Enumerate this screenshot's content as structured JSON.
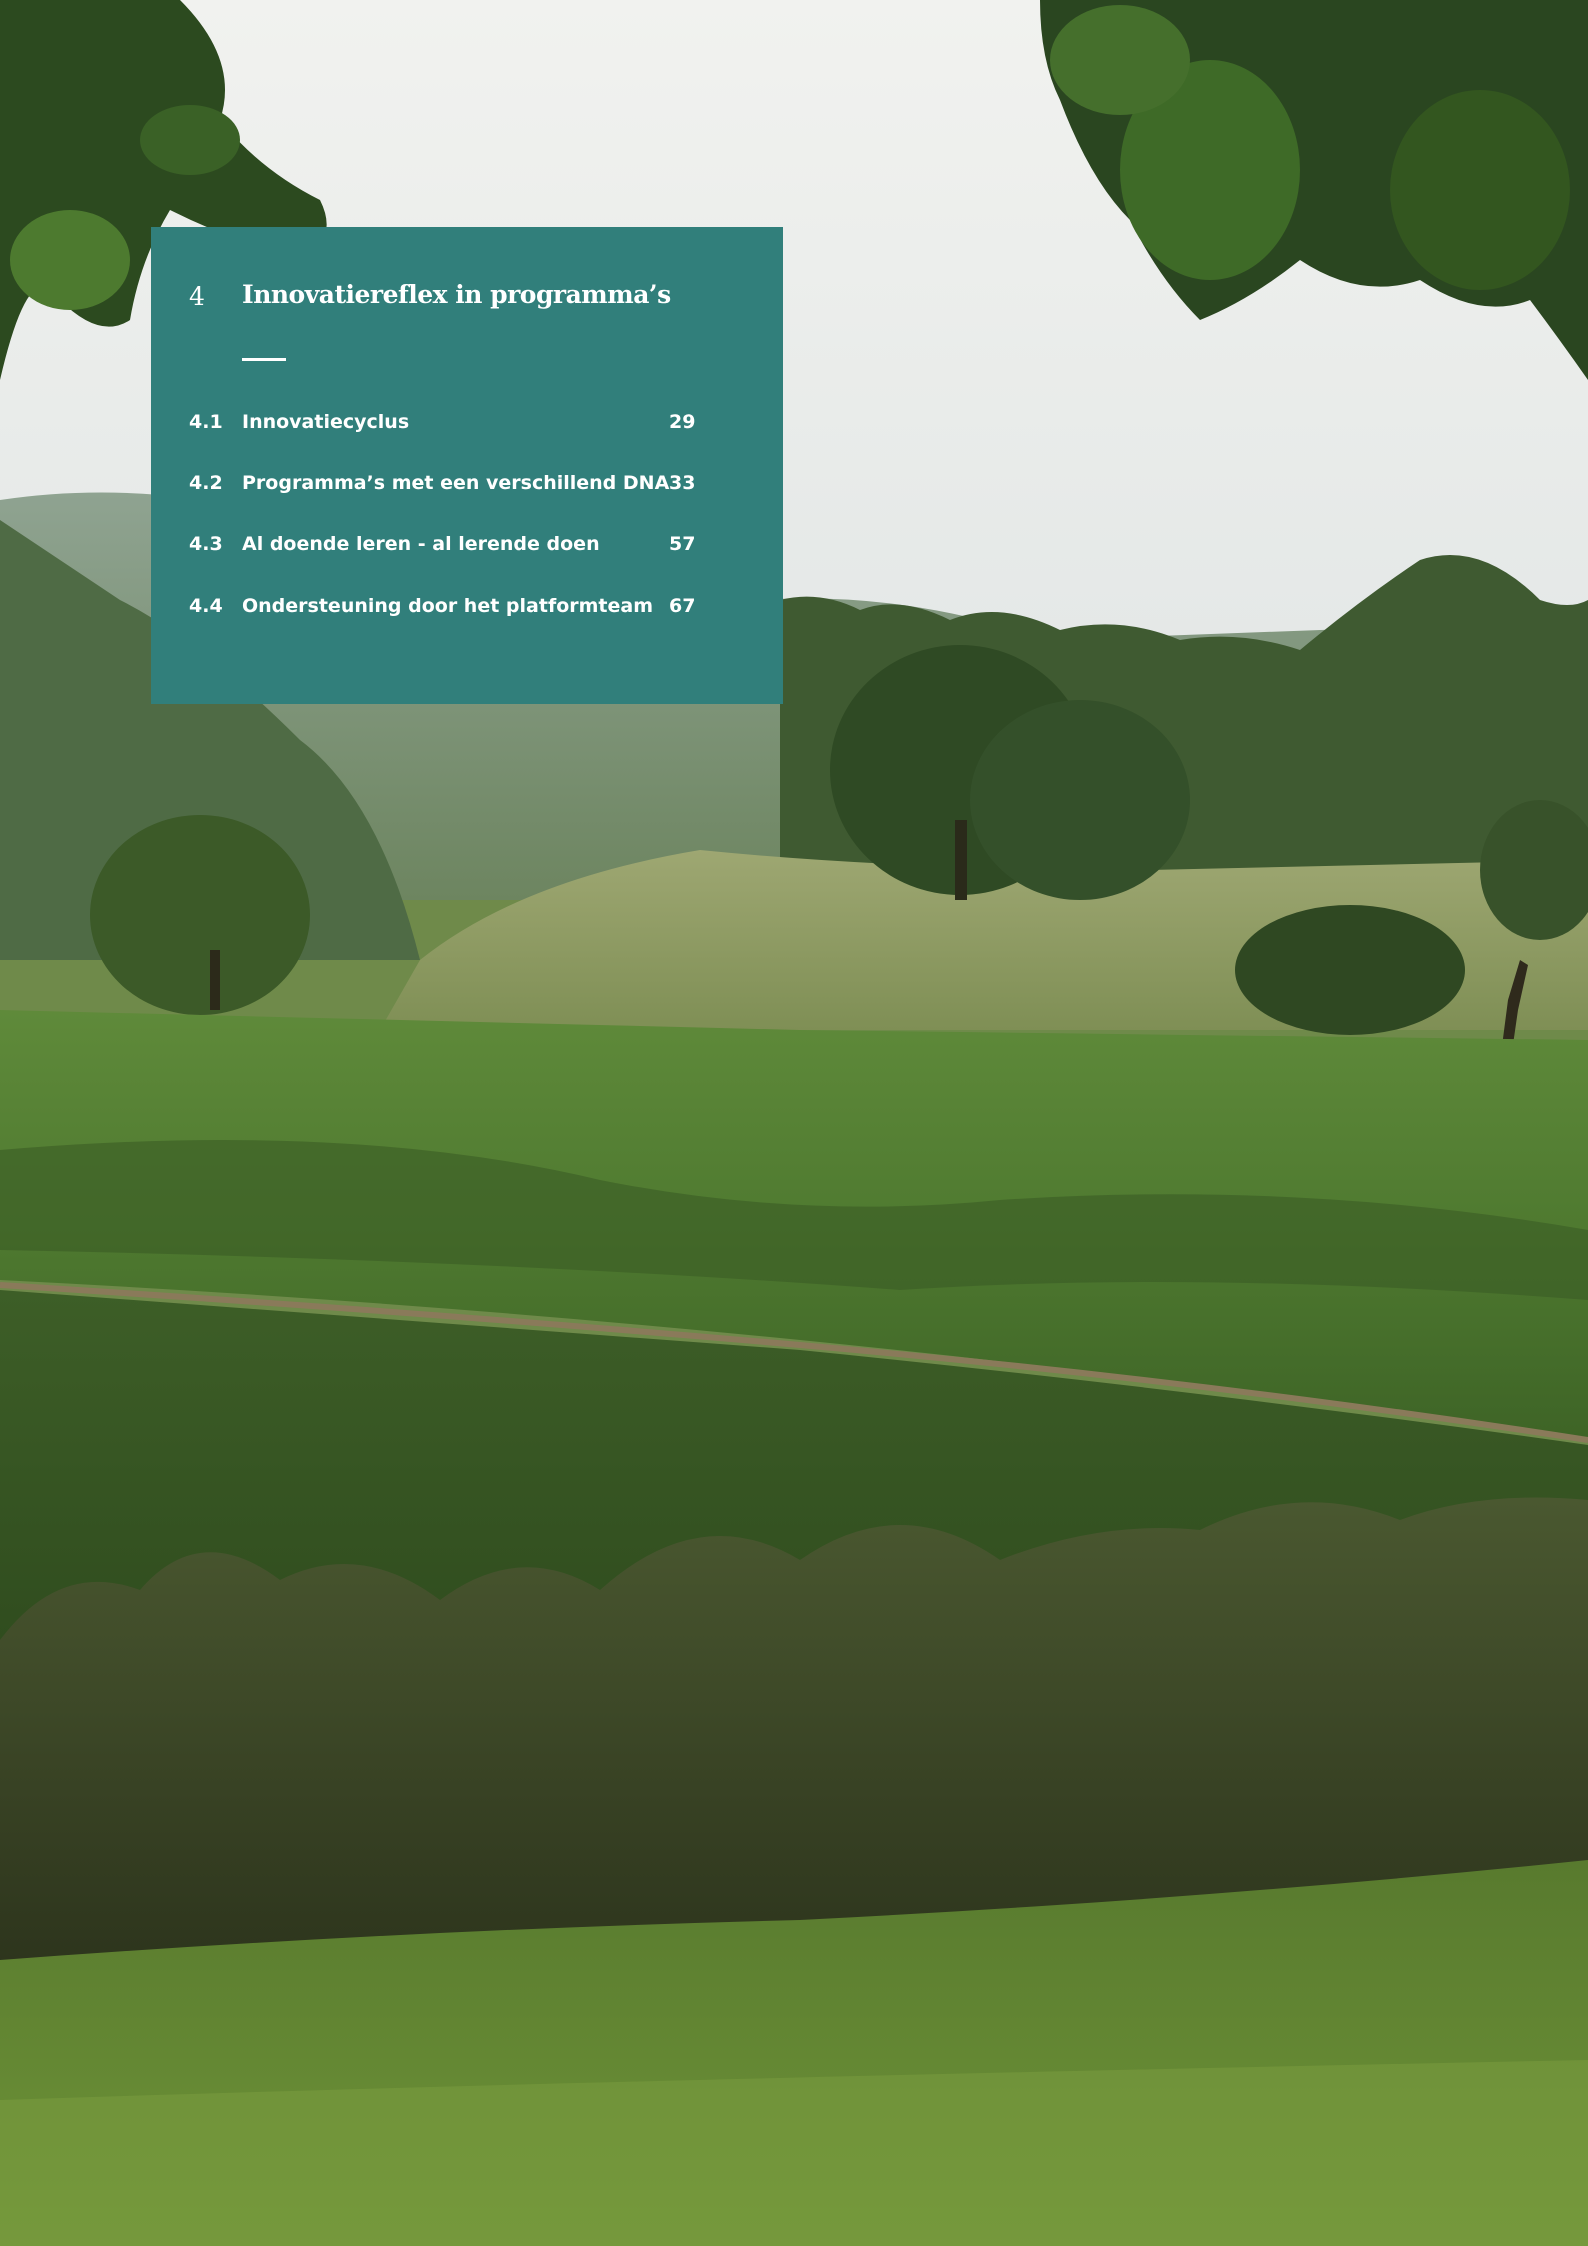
{
  "chapter": {
    "number": "4",
    "title": "Innovatiereflex in programma’s"
  },
  "toc": [
    {
      "number": "4.1",
      "title": "Innovatiecyclus",
      "page": "29"
    },
    {
      "number": "4.2",
      "title": "Programma’s met een verschillend DNA",
      "page": "33"
    },
    {
      "number": "4.3",
      "title": "Al doende leren - al lerende doen",
      "page": "57"
    },
    {
      "number": "4.4",
      "title": "Ondersteuning door het platformteam",
      "page": "67"
    }
  ],
  "colors": {
    "panel": "#317f7b",
    "text": "#ffffff"
  },
  "background_image": "rural-landscape-photo"
}
